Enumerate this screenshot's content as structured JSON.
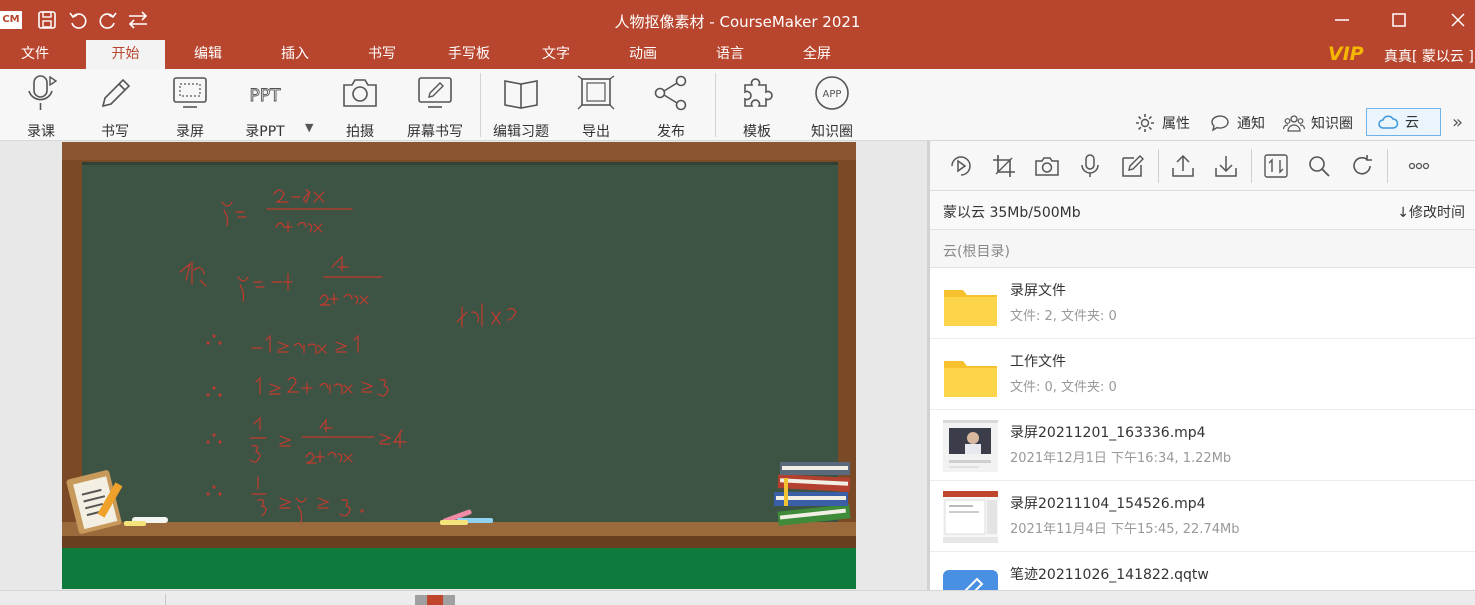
{
  "app": {
    "logo_text": "CM",
    "window_title": "人物抠像素材 - CourseMaker 2021"
  },
  "menu": {
    "items": [
      "文件",
      "开始",
      "编辑",
      "插入",
      "书写",
      "手写板",
      "文字",
      "动画",
      "语言",
      "全屏"
    ],
    "active": "开始",
    "vip_label": "VIP",
    "user_label": "真真[ 蒙以云 ]"
  },
  "toolbar": {
    "tools": [
      {
        "label": "录课",
        "icon": "mic-record-icon"
      },
      {
        "label": "书写",
        "icon": "pencil-icon"
      },
      {
        "label": "录屏",
        "icon": "screen-record-icon"
      },
      {
        "label": "录PPT",
        "icon": "ppt-icon"
      },
      {
        "label": "拍摄",
        "icon": "camera-icon"
      },
      {
        "label": "屏幕书写",
        "icon": "screen-write-icon"
      },
      {
        "label": "编辑习题",
        "icon": "book-icon"
      },
      {
        "label": "导出",
        "icon": "export-frame-icon"
      },
      {
        "label": "发布",
        "icon": "share-icon"
      },
      {
        "label": "模板",
        "icon": "puzzle-icon"
      },
      {
        "label": "知识圈",
        "icon": "app-circle-icon"
      }
    ],
    "dropdown_glyph": "▼",
    "right": {
      "properties": "属性",
      "notify": "通知",
      "knowledge_circle": "知识圈",
      "cloud": "云",
      "expand": "»"
    }
  },
  "blackboard": {
    "board_color": "#3d5445",
    "frame_color": "#7a4a26",
    "ledge_color": "#0e7a3c",
    "handwriting_color": "#c23a2e"
  },
  "panel": {
    "tool_icons": [
      "play-icon",
      "crop-icon",
      "camera-icon",
      "mic-icon",
      "edit-icon",
      "upload-icon",
      "download-icon",
      "sort-icon",
      "search-icon",
      "refresh-icon",
      "more-icon"
    ],
    "quota": "蒙以云 35Mb/500Mb",
    "sort_label": "↓修改时间",
    "path": "云(根目录)",
    "files": [
      {
        "name": "录屏文件",
        "meta": "文件: 2, 文件夹: 0",
        "kind": "folder"
      },
      {
        "name": "工作文件",
        "meta": "文件: 0, 文件夹: 0",
        "kind": "folder"
      },
      {
        "name": "录屏20211201_163336.mp4",
        "meta": "2021年12月1日 下午16:34, 1.22Mb",
        "kind": "video"
      },
      {
        "name": "录屏20211104_154526.mp4",
        "meta": "2021年11月4日 下午15:45, 22.74Mb",
        "kind": "video2"
      },
      {
        "name": "笔迹20211026_141822.qqtw",
        "meta": "",
        "kind": "ink"
      }
    ]
  },
  "colors": {
    "brand": "#b8462e",
    "cloud_accent": "#6fb2e6",
    "folder": "#f7c02d"
  }
}
